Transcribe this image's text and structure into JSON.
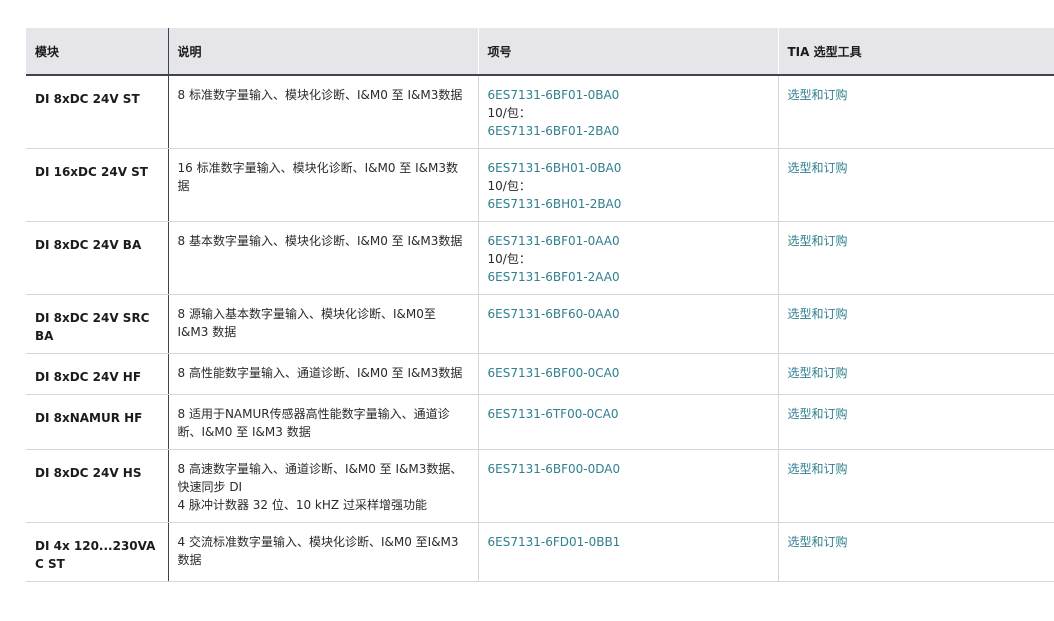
{
  "header": {
    "col1": "模块",
    "col2": "说明",
    "col3": "项号",
    "col4": "TIA 选型工具"
  },
  "rows": [
    {
      "model": "DI 8xDC 24V ST",
      "desc": [
        "8 标准数字量输入、模块化诊断、I&M0 至 I&M3数据"
      ],
      "code1": "6ES7131-6BF01-0BA0",
      "pack": "10/包：",
      "code2": "6ES7131-6BF01-2BA0",
      "tool": "选型和订购"
    },
    {
      "model": "DI 16xDC 24V ST",
      "desc": [
        "16 标准数字量输入、模块化诊断、I&M0 至 I&M3数",
        "据"
      ],
      "code1": "6ES7131-6BH01-0BA0",
      "pack": "10/包：",
      "code2": "6ES7131-6BH01-2BA0",
      "tool": "选型和订购"
    },
    {
      "model": "DI 8xDC 24V BA",
      "desc": [
        "8 基本数字量输入、模块化诊断、I&M0 至 I&M3数据"
      ],
      "code1": "6ES7131-6BF01-0AA0",
      "pack": "10/包：",
      "code2": "6ES7131-6BF01-2AA0",
      "tool": "选型和订购"
    },
    {
      "model": "DI 8xDC 24V SRC BA",
      "desc": [
        "8 源输入基本数字量输入、模块化诊断、I&M0至",
        "I&M3 数据"
      ],
      "code1": "6ES7131-6BF60-0AA0",
      "tool": "选型和订购"
    },
    {
      "model": "DI 8xDC 24V HF",
      "desc": [
        "8 高性能数字量输入、通道诊断、I&M0 至 I&M3数据"
      ],
      "code1": "6ES7131-6BF00-0CA0",
      "tool": "选型和订购"
    },
    {
      "model": "DI 8xNAMUR HF",
      "desc": [
        "8 适用于NAMUR传感器高性能数字量输入、通道诊",
        "断、I&M0 至 I&M3 数据"
      ],
      "code1": "6ES7131-6TF00-0CA0",
      "tool": "选型和订购"
    },
    {
      "model": "DI 8xDC 24V HS",
      "desc": [
        "8 高速数字量输入、通道诊断、I&M0 至 I&M3数据、",
        "快速同步 DI",
        "4 脉冲计数器 32 位、10 kHZ 过采样增强功能"
      ],
      "code1": "6ES7131-6BF00-0DA0",
      "tool": "选型和订购"
    },
    {
      "model": "DI 4x 120...230VAC ST",
      "desc": [
        "4 交流标准数字量输入、模块化诊断、I&M0 至I&M3",
        "数据"
      ],
      "code1": "6ES7131-6FD01-0BB1",
      "tool": "选型和订购"
    }
  ]
}
